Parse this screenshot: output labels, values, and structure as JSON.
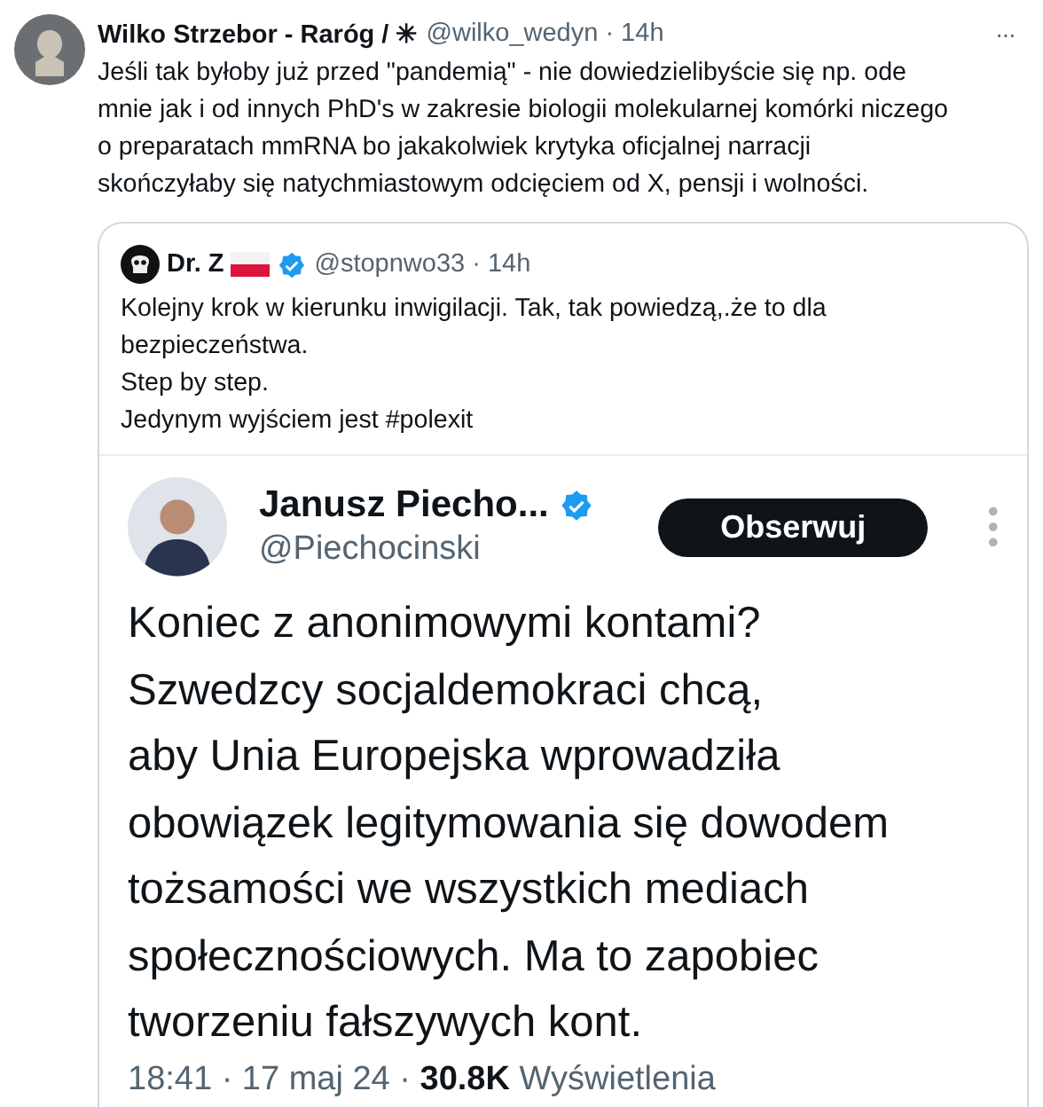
{
  "tweet": {
    "author": {
      "name": "Wilko Strzebor - Raróg / ✳",
      "meta": "@wilko_wedyn · 14h"
    },
    "more": "···",
    "text": "Jeśli tak byłoby już przed \"pandemią\" - nie dowiedzielibyście się np. ode\nmnie jak i od innych PhD's w zakresie biologii molekularnej komórki niczego\no preparatach mmRNA bo jakakolwiek krytyka oficjalnej narracji\nskończyłaby się natychmiastowym odcięciem od X, pensji i wolności.",
    "quote": {
      "author": {
        "name": "Dr. Z",
        "verified": true,
        "meta": "@stopnwo33 · 14h"
      },
      "text": "Kolejny krok w kierunku inwigilacji. Tak, tak powiedzą,.że to dla\nbezpieczeństwa.\nStep by step.\nJedynym wyjściem jest #polexit",
      "embedded": {
        "author": {
          "name": "Janusz Piecho...",
          "verified": true,
          "handle": "@Piechocinski"
        },
        "button": "Obserwuj",
        "text": "Koniec z anonimowymi kontami?\nSzwedzcy socjaldemokraci chcą,\naby Unia Europejska wprowadziła\nobowiązek legitymowania się dowodem\ntożsamości we wszystkich mediach\nspołecznościowych. Ma to zapobiec\ntworzeniu fałszywych kont.",
        "footer": "18:41 · 17 maj 24 · **30.8K** Wyświetlenia"
      }
    }
  }
}
